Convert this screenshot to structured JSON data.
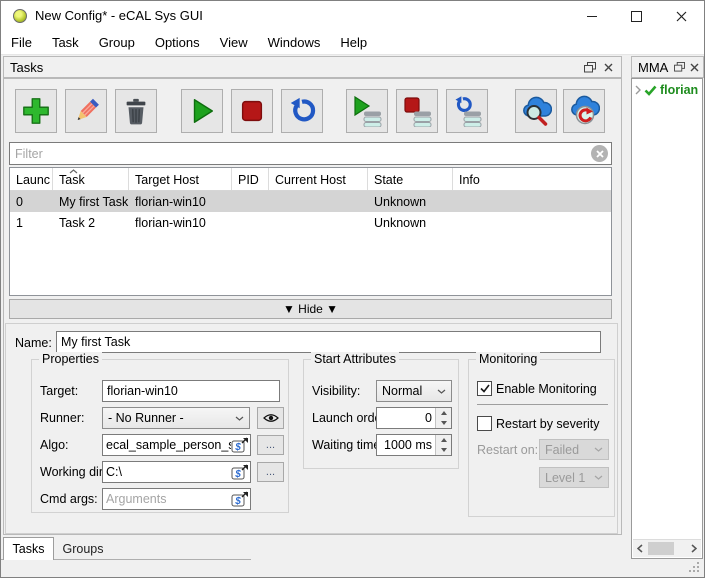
{
  "window": {
    "title": "New Config* - eCAL Sys GUI"
  },
  "menu": {
    "items": [
      "File",
      "Task",
      "Group",
      "Options",
      "View",
      "Windows",
      "Help"
    ]
  },
  "tasks_panel": {
    "title": "Tasks",
    "filter_placeholder": "Filter",
    "hide_button_label": "▼ Hide ▼",
    "toolbar_icons": [
      "plus-icon",
      "pencil-icon",
      "trash-icon",
      "play-icon",
      "stop-icon",
      "restart-icon",
      "play-list-icon",
      "stop-list-icon",
      "restart-list-icon",
      "cloud-search-icon",
      "cloud-refresh-icon"
    ],
    "table": {
      "columns": [
        "Launc",
        "Task",
        "Target Host",
        "PID",
        "Current Host",
        "State",
        "Info"
      ],
      "sorted_column": "Task",
      "rows": [
        {
          "launch": "0",
          "task": "My first Task",
          "target_host": "florian-win10",
          "pid": "",
          "current_host": "",
          "state": "Unknown",
          "info": "",
          "selected": true
        },
        {
          "launch": "1",
          "task": "Task 2",
          "target_host": "florian-win10",
          "pid": "",
          "current_host": "",
          "state": "Unknown",
          "info": "",
          "selected": false
        }
      ]
    }
  },
  "editor": {
    "name_label": "Name:",
    "name_value": "My first Task",
    "properties": {
      "title": "Properties",
      "target_label": "Target:",
      "target_value": "florian-win10",
      "runner_label": "Runner:",
      "runner_value": "- No Runner -",
      "algo_label": "Algo:",
      "algo_value": "ecal_sample_person_snd",
      "workdir_label": "Working dir:",
      "workdir_value": "C:\\",
      "cmdargs_label": "Cmd args:",
      "cmdargs_placeholder": "Arguments",
      "browse_label": "..."
    },
    "start_attributes": {
      "title": "Start Attributes",
      "visibility_label": "Visibility:",
      "visibility_value": "Normal",
      "launch_order_label": "Launch order:",
      "launch_order_value": "0",
      "waiting_time_label": "Waiting time:",
      "waiting_time_value": "1000 ms"
    },
    "monitoring": {
      "title": "Monitoring",
      "enable_monitoring_label": "Enable Monitoring",
      "enable_monitoring_checked": true,
      "restart_by_severity_label": "Restart by severity",
      "restart_by_severity_checked": false,
      "restart_on_label": "Restart on:",
      "restart_on_value": "Failed",
      "severity_level_value": "Level 1"
    }
  },
  "bottom_tabs": {
    "tasks": "Tasks",
    "groups": "Groups"
  },
  "mma_panel": {
    "title": "MMA",
    "host": "florian",
    "host_status_icon": "check-icon"
  },
  "colors": {
    "add_green": "#2eb82e",
    "stop_red": "#b51717",
    "action_blue": "#2158c4",
    "selection_gray": "#d4d4d4",
    "host_ok_green": "#1e8c1e"
  }
}
